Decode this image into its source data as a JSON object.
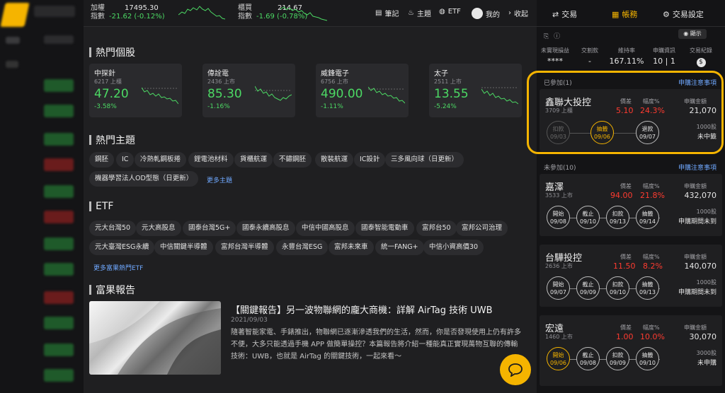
{
  "topbar": {
    "taiex": {
      "name_line1": "加權",
      "name_line2": "指數",
      "value": "17495.30",
      "change": "-21.62 (-0.12%)"
    },
    "otc": {
      "name_line1": "櫃買",
      "name_line2": "指數",
      "value": "214.67",
      "change": "-1.69 (-0.78%)"
    },
    "nav": [
      {
        "label": "筆記",
        "icon": "notebook-icon"
      },
      {
        "label": "主題",
        "icon": "fire-icon"
      },
      {
        "label": "ETF",
        "icon": "globe-icon"
      },
      {
        "label": "我的",
        "icon": "avatar-icon"
      },
      {
        "label": "收起",
        "icon": "chevron-right-icon"
      }
    ]
  },
  "hot_stocks": {
    "title": "熱門個股",
    "items": [
      {
        "name": "中探針",
        "code": "6217 上櫃",
        "price": "47.20",
        "change": "-3.58%"
      },
      {
        "name": "偉詮電",
        "code": "2436 上市",
        "price": "85.30",
        "change": "-1.16%"
      },
      {
        "name": "威鋒電子",
        "code": "6756 上市",
        "price": "490.00",
        "change": "-1.11%"
      },
      {
        "name": "太子",
        "code": "2511 上市",
        "price": "13.55",
        "change": "-5.24%"
      }
    ]
  },
  "hot_topics": {
    "title": "熱門主題",
    "chips": [
      "鋼胚",
      "IC",
      "冷熱軋鋼板捲",
      "鋰電池材料",
      "貨櫃航運",
      "不鏽鋼胚",
      "散裝航運",
      "IC設計",
      "三多風向球（日更新）",
      "機器學習法人OD型態（日更新）"
    ],
    "more": "更多主題"
  },
  "etf": {
    "title": "ETF",
    "chips": [
      "元大台灣50",
      "元大高股息",
      "國泰台灣5G+",
      "國泰永續高股息",
      "中信中國高股息",
      "國泰智能電動車",
      "富邦台50",
      "富邦公司治理",
      "元大臺灣ESG永續",
      "中信關鍵半導體",
      "富邦台灣半導體",
      "永豐台灣ESG",
      "富邦未來車",
      "統一FANG+",
      "中信小資高價30"
    ],
    "more": "更多富果熱門ETF"
  },
  "report": {
    "section": "富果報告",
    "title": "【關鍵報告】另一波物聯網的龐大商機：詳解 AirTag 技術 UWB",
    "date": "2021/09/03",
    "body": "隨著智能家電、手錶推出，物聯網已逐漸滲透我們的生活，然而，你是否發現使用上仍有許多不便，大多只能透過手機 APP 做簡單操控？本篇報告將介紹一種能真正實現萬物互聯的傳輸技術：UWB，也就是 AirTag 的關鍵技術，一起來看～"
  },
  "right_panel": {
    "tabs": [
      {
        "label": "交易",
        "icon": "exchange-icon"
      },
      {
        "label": "帳務",
        "icon": "ledger-icon"
      },
      {
        "label": "交易設定",
        "icon": "gear-icon"
      }
    ],
    "show_label": "顯示",
    "summary": [
      {
        "label": "未實現損益",
        "value": "****"
      },
      {
        "label": "交割款",
        "value": "-"
      },
      {
        "label": "維持率",
        "value": "167.11%"
      },
      {
        "label": "申購資訊",
        "value": "10 | 1"
      },
      {
        "label": "交易紀錄",
        "value": "$"
      }
    ],
    "joined_head": "已參加(1)",
    "notes_link": "申購注意事項",
    "not_joined_head": "未參加(10)",
    "labels": {
      "spread": "價差",
      "pct": "幅度%",
      "amount": "申購金額"
    },
    "ipos": [
      {
        "name": "鑫聯大投控",
        "code": "3709 上櫃",
        "spread": "5.10",
        "pct": "24.3%",
        "amount": "21,070",
        "shares": "1000股",
        "status": "未中籤",
        "steps": [
          {
            "t": "扣款",
            "d": "09/03"
          },
          {
            "t": "抽籤",
            "d": "09/06"
          },
          {
            "t": "退款",
            "d": "09/07"
          }
        ]
      },
      {
        "name": "嘉澤",
        "code": "3533 上市",
        "spread": "94.00",
        "pct": "21.8%",
        "amount": "432,070",
        "shares": "1000股",
        "status": "申購期間未到",
        "steps": [
          {
            "t": "開始",
            "d": "09/08"
          },
          {
            "t": "截止",
            "d": "09/10"
          },
          {
            "t": "扣款",
            "d": "09/13"
          },
          {
            "t": "抽籤",
            "d": "09/14"
          }
        ]
      },
      {
        "name": "台驊投控",
        "code": "2636 上市",
        "spread": "11.50",
        "pct": "8.2%",
        "amount": "140,070",
        "shares": "1000股",
        "status": "申購期間未到",
        "steps": [
          {
            "t": "開始",
            "d": "09/07"
          },
          {
            "t": "截止",
            "d": "09/09"
          },
          {
            "t": "扣款",
            "d": "09/10"
          },
          {
            "t": "抽籤",
            "d": "09/13"
          }
        ]
      },
      {
        "name": "宏遠",
        "code": "1460 上市",
        "spread": "1.00",
        "pct": "10.0%",
        "amount": "30,070",
        "shares": "3000股",
        "status": "未申購",
        "steps": [
          {
            "t": "開始",
            "d": "09/06"
          },
          {
            "t": "截止",
            "d": "09/08"
          },
          {
            "t": "扣款",
            "d": "09/09"
          },
          {
            "t": "抽籤",
            "d": "09/10"
          }
        ]
      }
    ]
  }
}
